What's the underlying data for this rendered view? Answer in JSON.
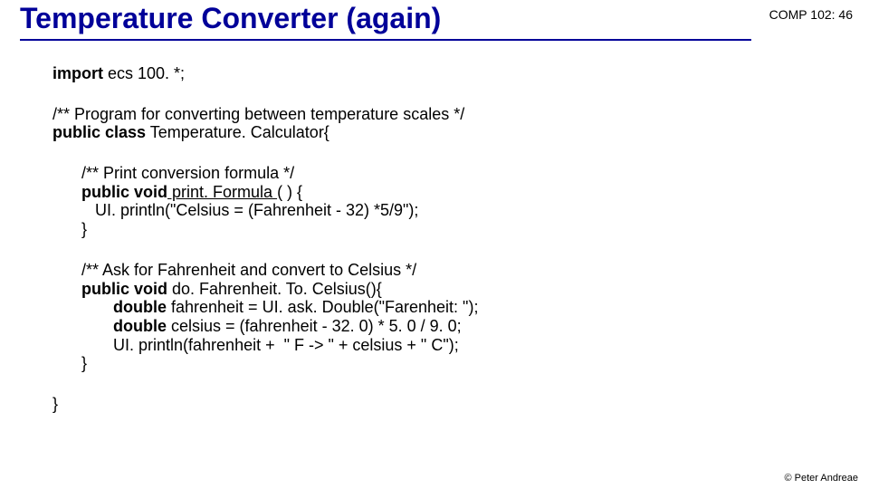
{
  "header": {
    "title": "Temperature Converter (again)",
    "course": "COMP 102: 46"
  },
  "code": {
    "importKw": "import",
    "importRest": " ecs 100. *;",
    "classComment": "/** Program for converting between temperature scales */",
    "pubclass": "public class",
    "className": " Temperature. Calculator{",
    "m1Comment": "/** Print conversion formula */",
    "m1Sig1": "public void",
    "m1Sig2": " print. Formula ",
    "m1Sig3": "( ) {",
    "m1Body": "   UI. println(\"Celsius = (Fahrenheit - 32) *5/9\");",
    "m1Close": "}",
    "m2Comment": "/** Ask for Fahrenheit and convert to Celsius */",
    "m2Sig1": "public void",
    "m2Sig2": " do. Fahrenheit. To. Celsius(){",
    "m2l1a": "       double",
    "m2l1b": " fahrenheit = UI. ask. Double(\"Farenheit: \");",
    "m2l2a": "       double",
    "m2l2b": " celsius = (fahrenheit - 32. 0) * 5. 0 / 9. 0;",
    "m2l3": "       UI. println(fahrenheit +  \" F -> \" + celsius + \" C\");",
    "m2Close": "}",
    "classClose": "}"
  },
  "footer": "© Peter Andreae"
}
